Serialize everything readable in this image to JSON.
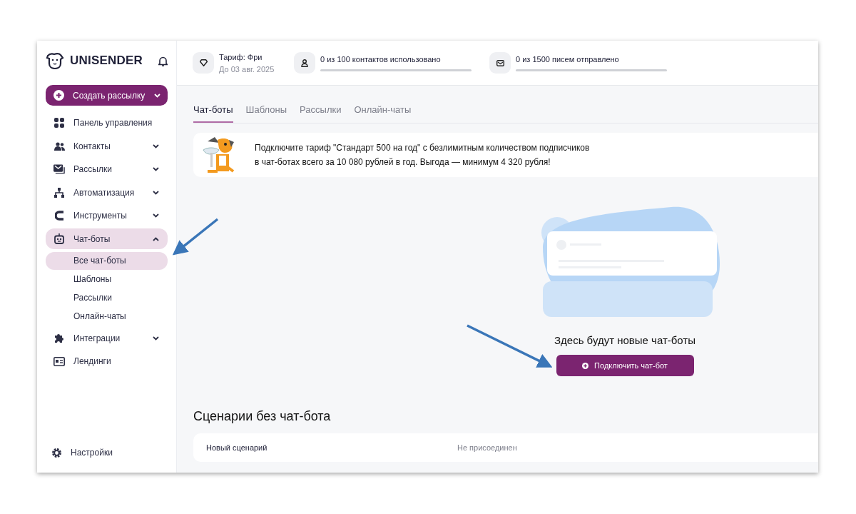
{
  "sidebar": {
    "logo": "UNISENDER",
    "create_button": {
      "label": "Создать рассылку"
    },
    "items": [
      {
        "label": "Панель управления",
        "selected": false
      },
      {
        "label": "Контакты",
        "selected": false,
        "expanded": false
      },
      {
        "label": "Рассылки",
        "selected": false,
        "expanded": false
      },
      {
        "label": "Автоматизация",
        "selected": false,
        "expanded": false
      },
      {
        "label": "Инструменты",
        "selected": false,
        "expanded": false
      },
      {
        "label": "Чат-боты",
        "selected": true,
        "expanded": true,
        "children": [
          {
            "label": "Все чат-боты",
            "selected": true
          },
          {
            "label": "Шаблоны",
            "selected": false
          },
          {
            "label": "Рассылки",
            "selected": false
          },
          {
            "label": "Онлайн-чаты",
            "selected": false
          }
        ]
      },
      {
        "label": "Интеграции",
        "selected": false,
        "expanded": false
      },
      {
        "label": "Лендинги",
        "selected": false
      }
    ],
    "settings": "Настройки"
  },
  "top_bar": {
    "plan": {
      "title": "Тариф: Фри",
      "subtitle": "До 03 авг. 2025"
    },
    "meters": [
      {
        "label": "0 из 100 контактов использовано",
        "level": 0
      },
      {
        "label": "0 из 1500 писем отправлено",
        "level": 0
      }
    ]
  },
  "tabs": [
    {
      "label": "Чат-боты",
      "selected": true
    },
    {
      "label": "Шаблоны",
      "selected": false
    },
    {
      "label": "Рассылки",
      "selected": false
    },
    {
      "label": "Онлайн-чаты",
      "selected": false
    }
  ],
  "banner": {
    "text": "Подключите тариф \"Стандарт 500 на год\" с безлимитным количеством подписчиков\nв чат-ботах всего за 10 080 рублей в год. Выгода — минимум 4 320 рубля!"
  },
  "empty_state": {
    "message": "Здесь будут новые чат-боты",
    "button": "Подключить чат-бот"
  },
  "scenarios": {
    "title": "Сценарии без чат-бота",
    "rows": [
      {
        "name": "Новый сценарий",
        "status": "Не присоединен"
      }
    ]
  }
}
